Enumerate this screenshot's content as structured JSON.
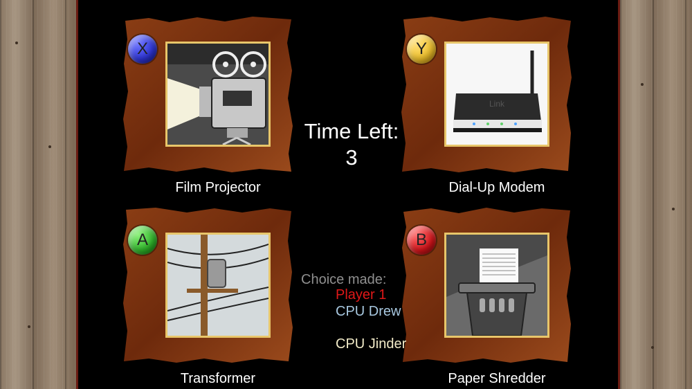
{
  "timer": {
    "label": "Time Left:",
    "value": "3"
  },
  "choices": {
    "title": "Choice made:",
    "items": [
      {
        "name": "Player 1",
        "color": "#e01818"
      },
      {
        "name": "CPU Drew",
        "color": "#a8c8e0"
      },
      {
        "name": "CPU Jinder",
        "color": "#f2ebc8"
      }
    ]
  },
  "options": [
    {
      "button": "X",
      "button_color": "#2d34d6",
      "caption": "Film Projector"
    },
    {
      "button": "Y",
      "button_color": "#f0c12a",
      "caption": "Dial-Up Modem"
    },
    {
      "button": "A",
      "button_color": "#2fb82a",
      "caption": "Transformer"
    },
    {
      "button": "B",
      "button_color": "#d8141a",
      "caption": "Paper Shredder"
    }
  ],
  "modem_brand": "Link"
}
